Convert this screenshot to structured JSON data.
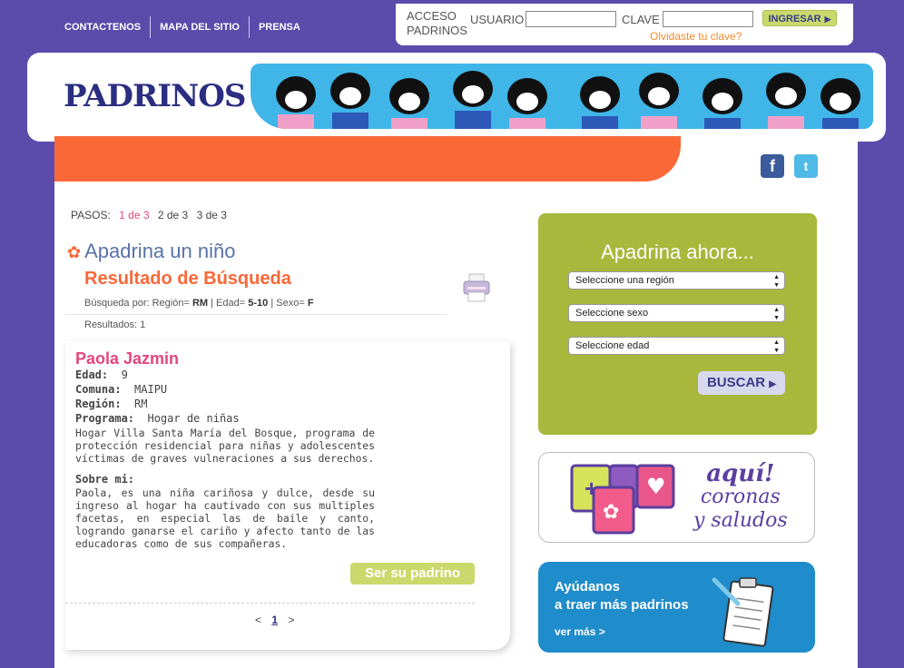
{
  "top_nav": [
    "CONTACTENOS",
    "MAPA DEL SITIO",
    "PRENSA"
  ],
  "login": {
    "title_line1": "ACCESO",
    "title_line2": "PADRINOS",
    "user_label": "USUARIO",
    "password_label": "CLAVE",
    "submit_label": "INGRESAR",
    "forgot_label": "Olvidaste tu clave?"
  },
  "logo_text": "PADRINOS",
  "steps": {
    "label": "PASOS:",
    "items": [
      "1 de 3",
      "2 de 3",
      "3 de 3"
    ]
  },
  "section_title": "Apadrina un niño",
  "result_title": "Resultado de Búsqueda",
  "search_by": {
    "label": "Búsqueda por: Región=",
    "region": "RM",
    "age_label": "| Edad=",
    "age": "5-10",
    "sex_label": "| Sexo=",
    "sex": "F"
  },
  "results": "Resultados: 1",
  "child": {
    "name": "Paola Jazmin",
    "age_label": "Edad:",
    "age": "9",
    "comuna_label": "Comuna:",
    "comuna": "MAIPU",
    "region_label": "Región:",
    "region": "RM",
    "program_label": "Programa:",
    "program": "Hogar de niñas",
    "program_desc": "Hogar Villa Santa María del Bosque, programa de protección residencial para niñas y adolescentes víctimas de graves vulneraciones a sus derechos.",
    "about_label": "Sobre mi:",
    "about": "Paola, es una niña cariñosa y dulce, desde su ingreso al hogar ha cautivado con sus multiples facetas, en especial las de baile y canto, logrando ganarse el cariño y afecto tanto de las educadoras como de sus compañeras."
  },
  "padrino_button": "Ser su padrino",
  "pager": {
    "prev": "<",
    "current": "1",
    "next": ">"
  },
  "sponsor": {
    "title": "Apadrina ahora...",
    "region_select": "Seleccione una región",
    "sex_select": "Seleccione sexo",
    "age_select": "Seleccione edad",
    "search_button": "BUSCAR"
  },
  "promo1": {
    "line1": "aquí!",
    "line2": "coronas",
    "line3": "y saludos"
  },
  "promo2": {
    "line1": "Ayúdanos",
    "line2": "a traer más padrinos",
    "link": "ver más >"
  },
  "colors": {
    "purple_bg": "#5b4bab",
    "orange": "#fa6838",
    "green": "#a7b83c",
    "pink": "#e4477b",
    "blue": "#1f8ccb"
  }
}
